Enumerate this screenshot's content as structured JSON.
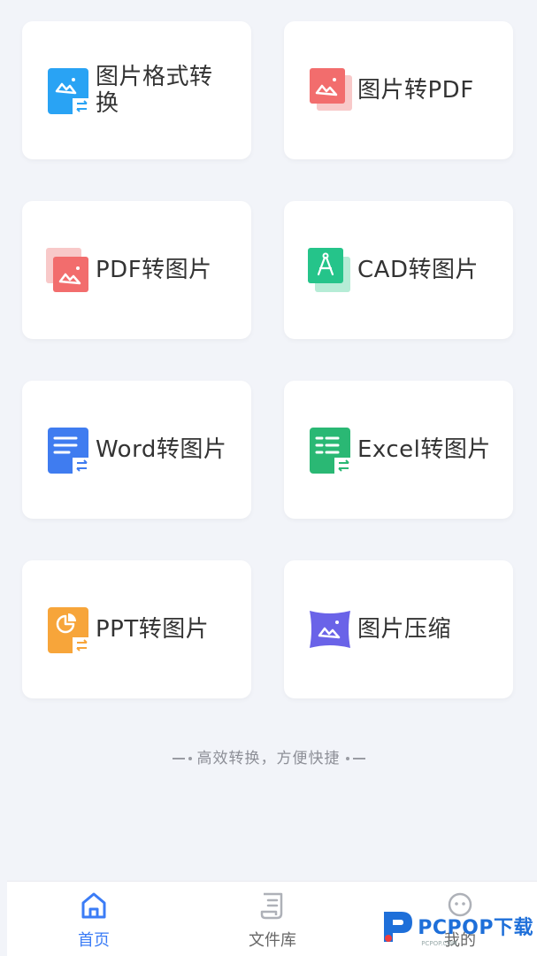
{
  "tools": [
    {
      "id": "img-format",
      "label": "图片格式转换",
      "icon": "image-convert-icon",
      "color": "#29a3f4"
    },
    {
      "id": "img-pdf",
      "label": "图片转PDF",
      "icon": "image-to-pdf-icon",
      "color": "#f26d6d"
    },
    {
      "id": "pdf-img",
      "label": "PDF转图片",
      "icon": "pdf-to-image-icon",
      "color": "#f26d6d"
    },
    {
      "id": "cad-img",
      "label": "CAD转图片",
      "icon": "cad-to-image-icon",
      "color": "#25c48a"
    },
    {
      "id": "word-img",
      "label": "Word转图片",
      "icon": "word-to-image-icon",
      "color": "#3f7cf0"
    },
    {
      "id": "excel-img",
      "label": "Excel转图片",
      "icon": "excel-to-image-icon",
      "color": "#2ab874"
    },
    {
      "id": "ppt-img",
      "label": "PPT转图片",
      "icon": "ppt-to-image-icon",
      "color": "#f7a53a"
    },
    {
      "id": "img-compress",
      "label": "图片压缩",
      "icon": "image-compress-icon",
      "color": "#6a63e8"
    }
  ],
  "slogan": "高效转换，方便快捷",
  "tabbar": {
    "home": "首页",
    "files": "文件库",
    "mine": "我的",
    "active_color": "#3b7cf6"
  },
  "watermark": {
    "brand": "PCPOP下载",
    "sub": "PCPOP.COM"
  }
}
